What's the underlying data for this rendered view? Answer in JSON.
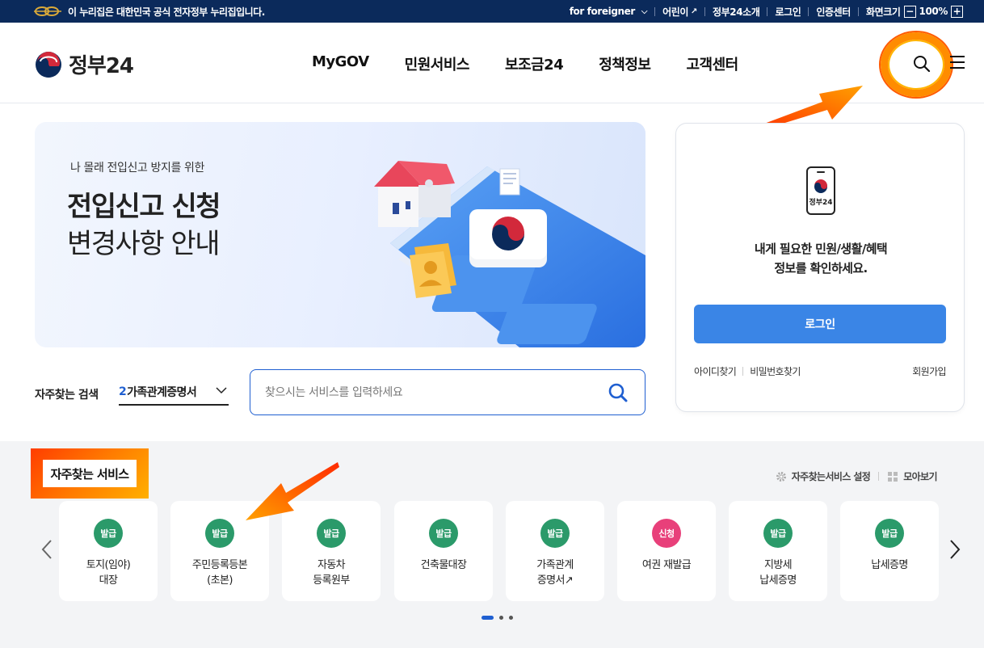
{
  "topbar": {
    "notice": "이 누리집은 대한민국 공식 전자정부 누리집입니다.",
    "links": [
      "for foreigner",
      "어린이",
      "정부24소개",
      "로그인",
      "인증센터",
      "화면크기"
    ],
    "zoom_minus": "−",
    "zoom_value": "100%",
    "zoom_plus": "+"
  },
  "header": {
    "logo_text": "정부24",
    "nav": [
      "MyGOV",
      "민원서비스",
      "보조금24",
      "정책정보",
      "고객센터"
    ]
  },
  "banner": {
    "subtitle": "나 몰래 전입신고 방지를 위한",
    "title_line1": "전입신고 신청",
    "title_line2": "변경사항 안내"
  },
  "frequent_search": {
    "label": "자주찾는 검색",
    "select_num": "2",
    "select_text": "가족관계증명서",
    "placeholder": "찾으시는 서비스를 입력하세요"
  },
  "login_card": {
    "phone_label": "정부24",
    "message_line1": "내게 필요한 민원/생활/혜택",
    "message_line2": "정보를 확인하세요.",
    "login_button": "로그인",
    "find_id": "아이디찾기",
    "find_pw": "비밀번호찾기",
    "join": "회원가입"
  },
  "favorites": {
    "title": "자주찾는 서비스",
    "settings": "자주찾는서비스 설정",
    "view_all": "모아보기",
    "cards": [
      {
        "badge": "발급",
        "color": "#2b9a6a",
        "label": "토지(임야)\n대장"
      },
      {
        "badge": "발급",
        "color": "#2b9a6a",
        "label": "주민등록등본\n(초본)"
      },
      {
        "badge": "발급",
        "color": "#2b9a6a",
        "label": "자동차\n등록원부"
      },
      {
        "badge": "발급",
        "color": "#2b9a6a",
        "label": "건축물대장"
      },
      {
        "badge": "발급",
        "color": "#2b9a6a",
        "label": "가족관계\n증명서↗"
      },
      {
        "badge": "신청",
        "color": "#e8407a",
        "label": "여권 재발급"
      },
      {
        "badge": "발급",
        "color": "#2b9a6a",
        "label": "지방세\n납세증명"
      },
      {
        "badge": "발급",
        "color": "#2b9a6a",
        "label": "납세증명"
      }
    ]
  },
  "colors": {
    "topbar_bg": "#0b2a5b",
    "accent_blue": "#1f5fd1",
    "login_button": "#3a85e6",
    "annotation": "#ff6a00"
  }
}
